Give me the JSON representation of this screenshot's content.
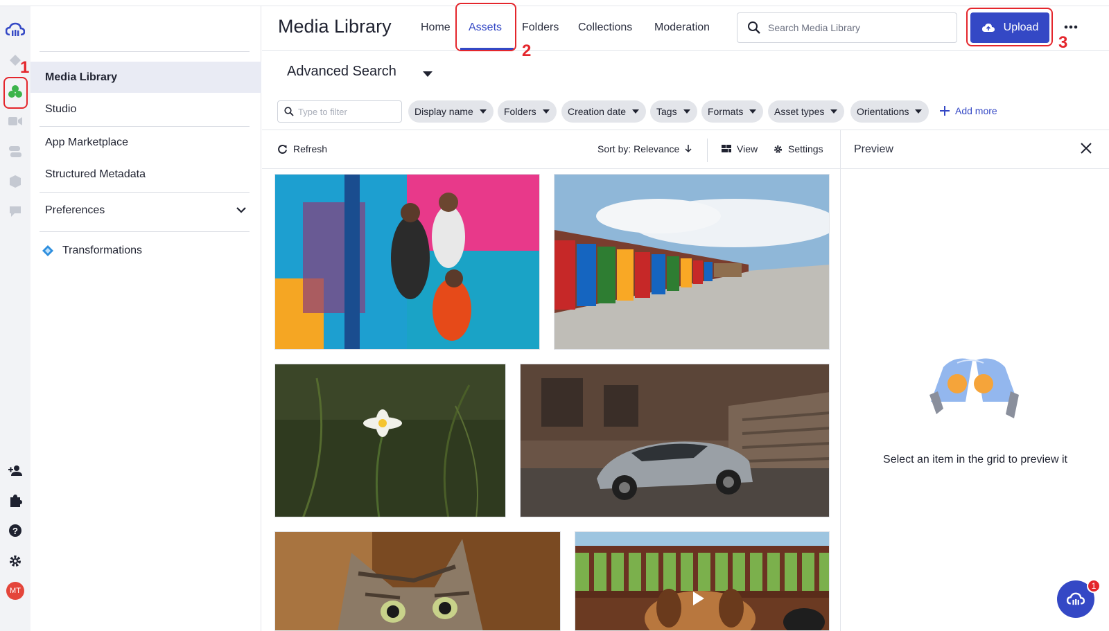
{
  "sidebar": {
    "items": [
      {
        "label": "Media Library",
        "active": true
      },
      {
        "label": "Studio"
      },
      {
        "label": "App Marketplace"
      },
      {
        "label": "Structured Metadata"
      },
      {
        "label": "Preferences"
      },
      {
        "label": "Transformations"
      }
    ]
  },
  "rail": {
    "icons": [
      "cloudinary-logo-icon",
      "diamond-icon",
      "media-library-icon",
      "video-icon",
      "layers-icon",
      "cube-icon",
      "chat-icon"
    ],
    "bottom_icons": [
      "add-user-icon",
      "puzzle-icon",
      "help-icon",
      "gear-icon"
    ],
    "avatar_initials": "MT"
  },
  "header": {
    "title": "Media Library",
    "tabs": [
      {
        "label": "Home"
      },
      {
        "label": "Assets",
        "active": true
      },
      {
        "label": "Folders"
      },
      {
        "label": "Collections"
      },
      {
        "label": "Moderation"
      }
    ],
    "search_placeholder": "Search Media Library",
    "upload_label": "Upload"
  },
  "annotations": [
    "1",
    "2",
    "3"
  ],
  "advanced_search": {
    "title": "Advanced Search",
    "filter_placeholder": "Type to filter",
    "chips": [
      "Display name",
      "Folders",
      "Creation date",
      "Tags",
      "Formats",
      "Asset types",
      "Orientations"
    ],
    "add_more": "Add more"
  },
  "toolbar": {
    "refresh": "Refresh",
    "sort": "Sort by: Relevance",
    "view": "View",
    "settings": "Settings"
  },
  "preview": {
    "title": "Preview",
    "message": "Select an item in the grid to preview it"
  },
  "chat": {
    "badge": "1"
  },
  "colors": {
    "accent": "#3448c5",
    "annotation": "#e4262c",
    "rail_bg": "#f2f3f6"
  }
}
